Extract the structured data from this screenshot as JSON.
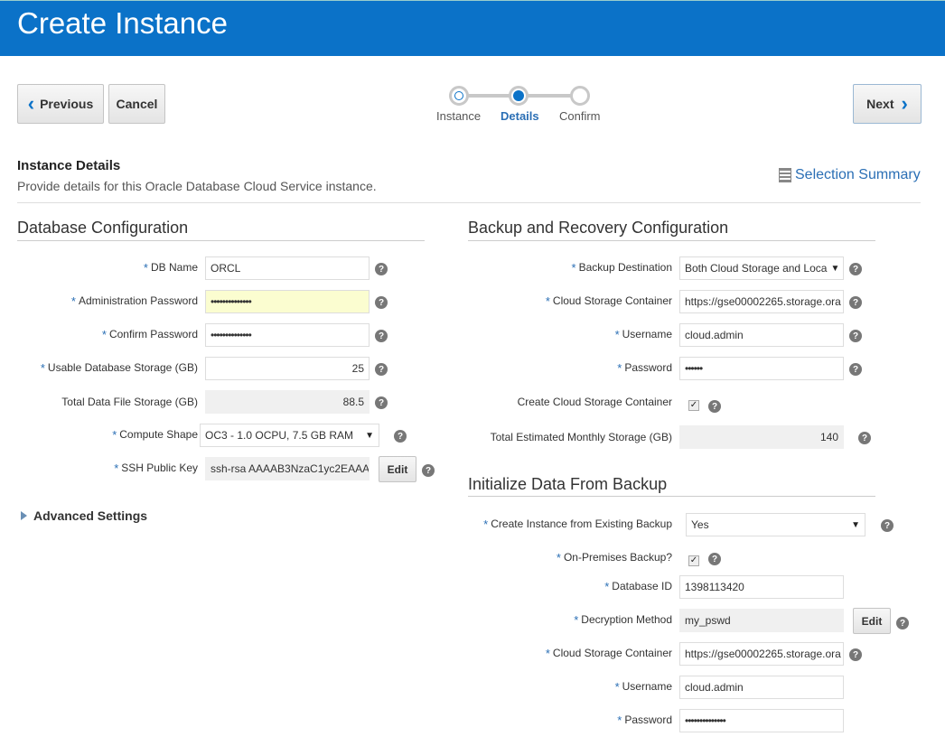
{
  "header": {
    "title": "Create Instance"
  },
  "toolbar": {
    "previous": "Previous",
    "cancel": "Cancel",
    "next": "Next"
  },
  "train": {
    "steps": [
      "Instance",
      "Details",
      "Confirm"
    ],
    "current": "Details"
  },
  "section": {
    "title": "Instance Details",
    "description": "Provide details for this Oracle Database Cloud Service instance.",
    "summary_link": "Selection Summary"
  },
  "db_config": {
    "title": "Database Configuration",
    "db_name_label": "DB Name",
    "db_name_value": "ORCL",
    "admin_password_label": "Administration Password",
    "admin_password_value": "••••••••••••••",
    "confirm_password_label": "Confirm Password",
    "confirm_password_value": "••••••••••••••",
    "usable_storage_label": "Usable Database Storage (GB)",
    "usable_storage_value": "25",
    "total_storage_label": "Total Data File Storage (GB)",
    "total_storage_value": "88.5",
    "compute_shape_label": "Compute Shape",
    "compute_shape_value": "OC3 - 1.0 OCPU, 7.5 GB RAM",
    "ssh_key_label": "SSH Public Key",
    "ssh_key_value": "ssh-rsa AAAAB3NzaC1yc2EAAA",
    "edit_label": "Edit",
    "advanced_settings": "Advanced Settings"
  },
  "backup_config": {
    "title": "Backup and Recovery Configuration",
    "destination_label": "Backup Destination",
    "destination_value": "Both Cloud Storage and Loca",
    "container_label": "Cloud Storage Container",
    "container_value": "https://gse00002265.storage.ora",
    "username_label": "Username",
    "username_value": "cloud.admin",
    "password_label": "Password",
    "password_value": "••••••",
    "create_container_label": "Create Cloud Storage Container",
    "create_container_checked": true,
    "monthly_storage_label": "Total Estimated Monthly Storage (GB)",
    "monthly_storage_value": "140"
  },
  "init_backup": {
    "title": "Initialize Data From Backup",
    "create_from_backup_label": "Create Instance from Existing Backup",
    "create_from_backup_value": "Yes",
    "on_prem_label": "On-Premises Backup?",
    "on_prem_checked": true,
    "database_id_label": "Database ID",
    "database_id_value": "1398113420",
    "decryption_label": "Decryption Method",
    "decryption_value": "my_pswd",
    "edit_label": "Edit",
    "container_label": "Cloud Storage Container",
    "container_value": "https://gse00002265.storage.ora",
    "username_label": "Username",
    "username_value": "cloud.admin",
    "password_label": "Password",
    "password_value": "••••••••••••••"
  },
  "colors": {
    "brand": "#0b72c8",
    "link": "#2b6fb5",
    "required": "#2b6fb5"
  },
  "icons": {
    "help": "?",
    "check": "✓",
    "prev": "‹",
    "next": "›",
    "dropdown": "▼"
  }
}
